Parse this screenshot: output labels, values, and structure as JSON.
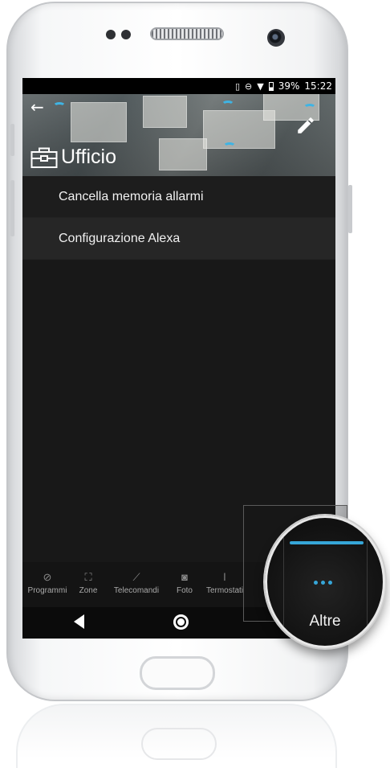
{
  "status_bar": {
    "battery": "39%",
    "time": "15:22"
  },
  "header": {
    "title": "Ufficio"
  },
  "menu": {
    "items": [
      {
        "label": "Cancella memoria allarmi"
      },
      {
        "label": "Configurazione Alexa"
      }
    ]
  },
  "tabs": [
    {
      "label": "Programmi",
      "icon": "rocket-icon"
    },
    {
      "label": "Zone",
      "icon": "zone-frame-icon"
    },
    {
      "label": "Telecomandi",
      "icon": "remote-icon"
    },
    {
      "label": "Foto",
      "icon": "camera-icon"
    },
    {
      "label": "Termostati",
      "icon": "thermometer-icon"
    }
  ],
  "magnifier": {
    "label": "Altre"
  },
  "colors": {
    "accent": "#36a6d8",
    "background": "#181818",
    "text": "#f1f1f1"
  }
}
